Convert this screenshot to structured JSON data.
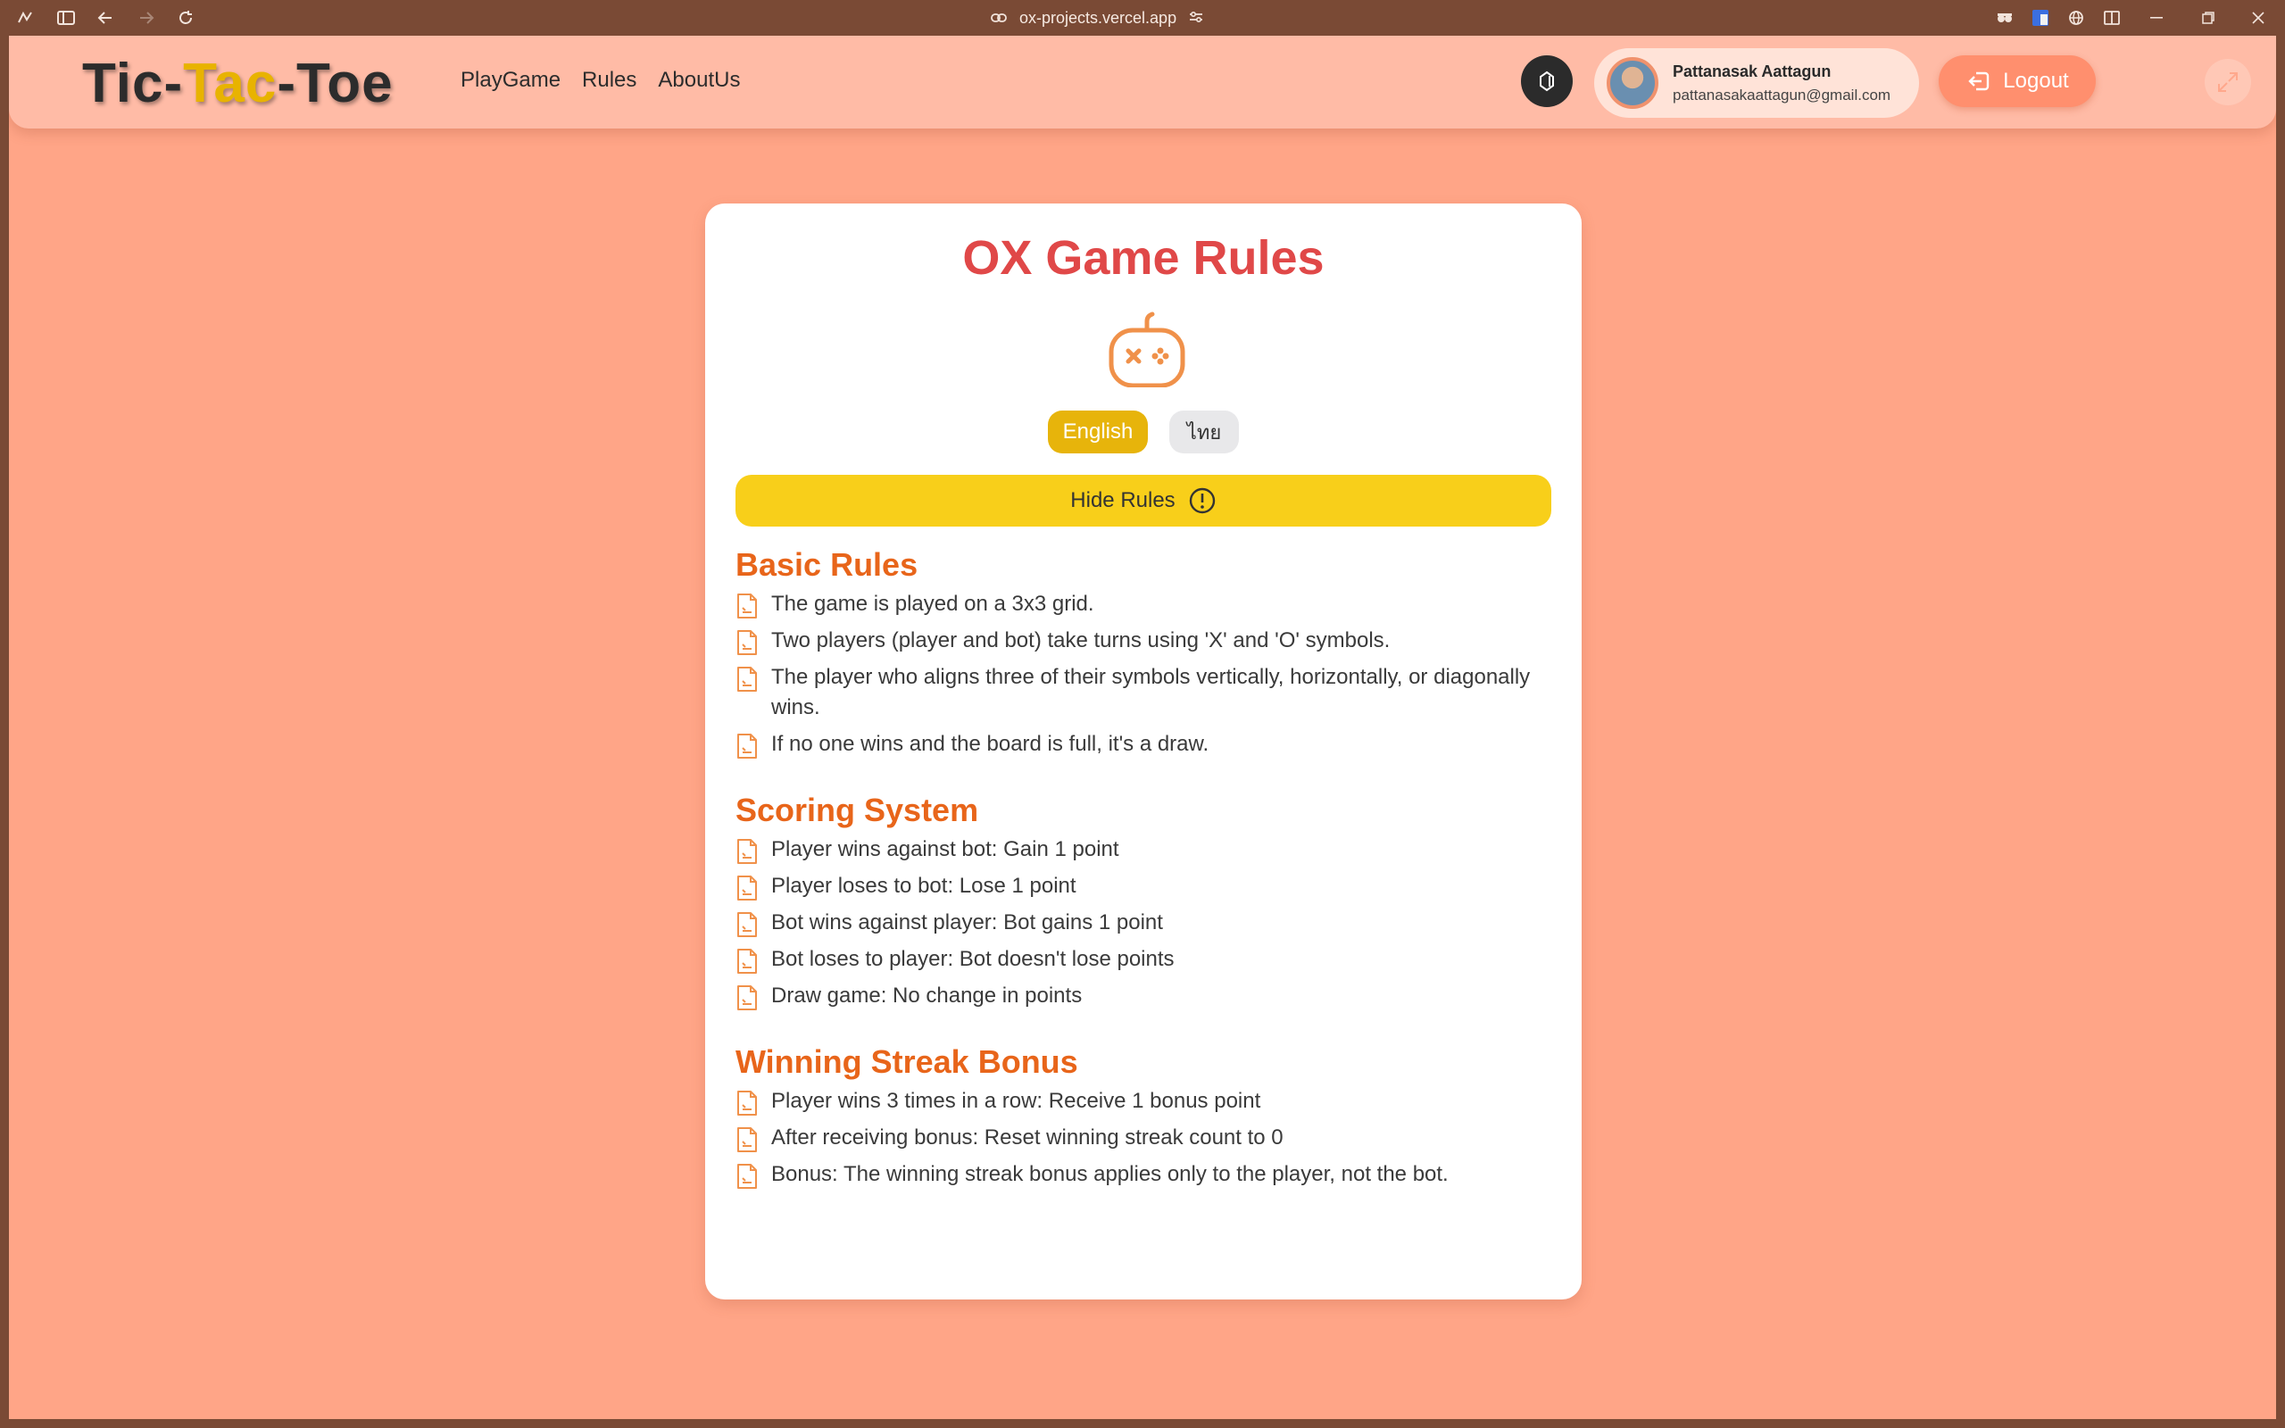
{
  "browser": {
    "url": "ox-projects.vercel.app"
  },
  "header": {
    "logo_part1": "Tic-",
    "logo_part2": "Tac",
    "logo_part3": "-Toe",
    "nav": [
      "PlayGame",
      "Rules",
      "AboutUs"
    ],
    "user_name": "Pattanasak Aattagun",
    "user_email": "pattanasakaattagun@gmail.com",
    "logout_label": "Logout"
  },
  "card": {
    "title": "OX Game Rules",
    "lang_english": "English",
    "lang_thai": "ไทย",
    "hide_rules_label": "Hide Rules",
    "sections": [
      {
        "title": "Basic Rules",
        "items": [
          "The game is played on a 3x3 grid.",
          "Two players (player and bot) take turns using 'X' and 'O' symbols.",
          "The player who aligns three of their symbols vertically, horizontally, or diagonally wins.",
          "If no one wins and the board is full, it's a draw."
        ]
      },
      {
        "title": "Scoring System",
        "items": [
          "Player wins against bot: Gain 1 point",
          "Player loses to bot: Lose 1 point",
          "Bot wins against player: Bot gains 1 point",
          "Bot loses to player: Bot doesn't lose points",
          "Draw game: No change in points"
        ]
      },
      {
        "title": "Winning Streak Bonus",
        "items": [
          "Player wins 3 times in a row: Receive 1 bonus point",
          "After receiving bonus: Reset winning streak count to 0",
          "Bonus: The winning streak bonus applies only to the player, not the bot."
        ]
      }
    ]
  },
  "colors": {
    "background": "#ffa587",
    "header": "#ffbba6",
    "title_red": "#e04848",
    "section_orange": "#e8651a",
    "english_button": "#e7b40b",
    "hide_button": "#f8cf1a",
    "logout_button": "#ff8f6e"
  },
  "icons": [
    "game-controller-icon",
    "document-icon",
    "info-icon",
    "logout-icon",
    "theme-toggle-icon",
    "expand-icon"
  ]
}
